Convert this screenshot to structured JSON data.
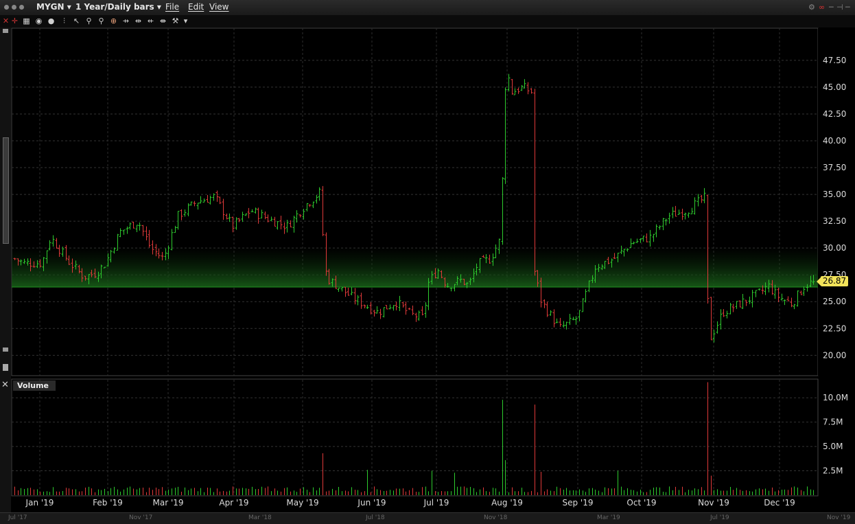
{
  "window": {
    "symbol": "MYGN",
    "period": "1 Year/Daily bars",
    "menus": [
      "File",
      "Edit",
      "View"
    ]
  },
  "icons": [
    "close-icon",
    "crosshair-icon",
    "grid-icon",
    "eye-icon",
    "circle-icon",
    "line-icon",
    "cursor-icon",
    "zoom-in-icon",
    "zoom-out-icon",
    "target-icon",
    "fit-left-icon",
    "fit-center-icon",
    "fit-right-icon",
    "wrench-icon",
    "dropdown-icon"
  ],
  "last_price": "26.87",
  "volume_panel": {
    "label": "Volume"
  },
  "navigator": {
    "labels": [
      "Jul '17",
      "Nov '17",
      "Mar '18",
      "Jul '18",
      "Nov '18",
      "Mar '19",
      "Jul '19",
      "Nov '19"
    ]
  },
  "colors": {
    "up": "#2ecc2e",
    "down": "#e23a3a",
    "doji": "#ffffff",
    "highlight": "#f2e35a"
  },
  "chart_data": [
    {
      "type": "ohlc",
      "title": "MYGN 1 Year/Daily bars",
      "x_tick_labels": [
        "Jan '19",
        "Feb '19",
        "Mar '19",
        "Apr '19",
        "May '19",
        "Jun '19",
        "Jul '19",
        "Aug '19",
        "Sep '19",
        "Oct '19",
        "Nov '19",
        "Dec '19"
      ],
      "y_tick_labels": [
        "20.00",
        "22.50",
        "25.00",
        "27.50",
        "30.00",
        "32.50",
        "35.00",
        "37.50",
        "40.00",
        "42.50",
        "45.00",
        "47.50"
      ],
      "ylim": [
        18.1,
        50.5
      ],
      "grid": true,
      "close_path": [
        [
          0,
          29
        ],
        [
          5,
          28.6
        ],
        [
          15,
          28.6
        ],
        [
          20,
          31
        ],
        [
          30,
          28.7
        ],
        [
          38,
          27.3
        ],
        [
          45,
          27.7
        ],
        [
          50,
          28.6
        ],
        [
          58,
          31.5
        ],
        [
          68,
          32.5
        ],
        [
          75,
          30
        ],
        [
          82,
          29
        ],
        [
          90,
          33
        ],
        [
          100,
          34.3
        ],
        [
          110,
          34.8
        ],
        [
          120,
          32
        ],
        [
          130,
          33.5
        ],
        [
          140,
          32.7
        ],
        [
          150,
          32
        ],
        [
          160,
          34
        ],
        [
          169,
          35.3
        ],
        [
          170,
          29
        ],
        [
          172,
          27.2
        ],
        [
          185,
          25.5
        ],
        [
          200,
          24
        ],
        [
          210,
          25
        ],
        [
          218,
          23.8
        ],
        [
          225,
          23.5
        ],
        [
          228,
          26.8
        ],
        [
          233,
          28
        ],
        [
          238,
          26.5
        ],
        [
          246,
          27
        ],
        [
          250,
          26.5
        ],
        [
          255,
          28.5
        ],
        [
          262,
          29
        ],
        [
          268,
          31
        ],
        [
          269,
          40
        ],
        [
          271,
          47.5
        ],
        [
          273,
          44.5
        ],
        [
          280,
          45
        ],
        [
          285,
          44.5
        ],
        [
          286,
          28
        ],
        [
          290,
          25
        ],
        [
          300,
          22.5
        ],
        [
          310,
          23.5
        ],
        [
          320,
          28.3
        ],
        [
          330,
          29
        ],
        [
          340,
          30.5
        ],
        [
          350,
          31
        ],
        [
          360,
          33
        ],
        [
          370,
          33.5
        ],
        [
          381,
          34.8
        ],
        [
          382,
          20.5
        ],
        [
          383,
          21.5
        ],
        [
          390,
          24
        ],
        [
          405,
          25.3
        ],
        [
          410,
          25.8
        ],
        [
          415,
          26.5
        ],
        [
          420,
          25.5
        ],
        [
          428,
          24.8
        ],
        [
          435,
          26.5
        ],
        [
          440,
          26.87
        ]
      ],
      "bar_count": 250,
      "volume": {
        "y_tick_labels": [
          "2.5M",
          "5.0M",
          "7.5M",
          "10.0M"
        ],
        "ylim": [
          0,
          11.85
        ],
        "spikes": {
          "170": 4.3,
          "195": 2.6,
          "230": 2.5,
          "242": 2.3,
          "269": 9.8,
          "270": 3.6,
          "286": 9.3,
          "290": 2.4,
          "332": 2.5,
          "382": 11.6,
          "383": 3.8,
          "384": 2.0
        },
        "baseline": 0.6
      }
    }
  ]
}
